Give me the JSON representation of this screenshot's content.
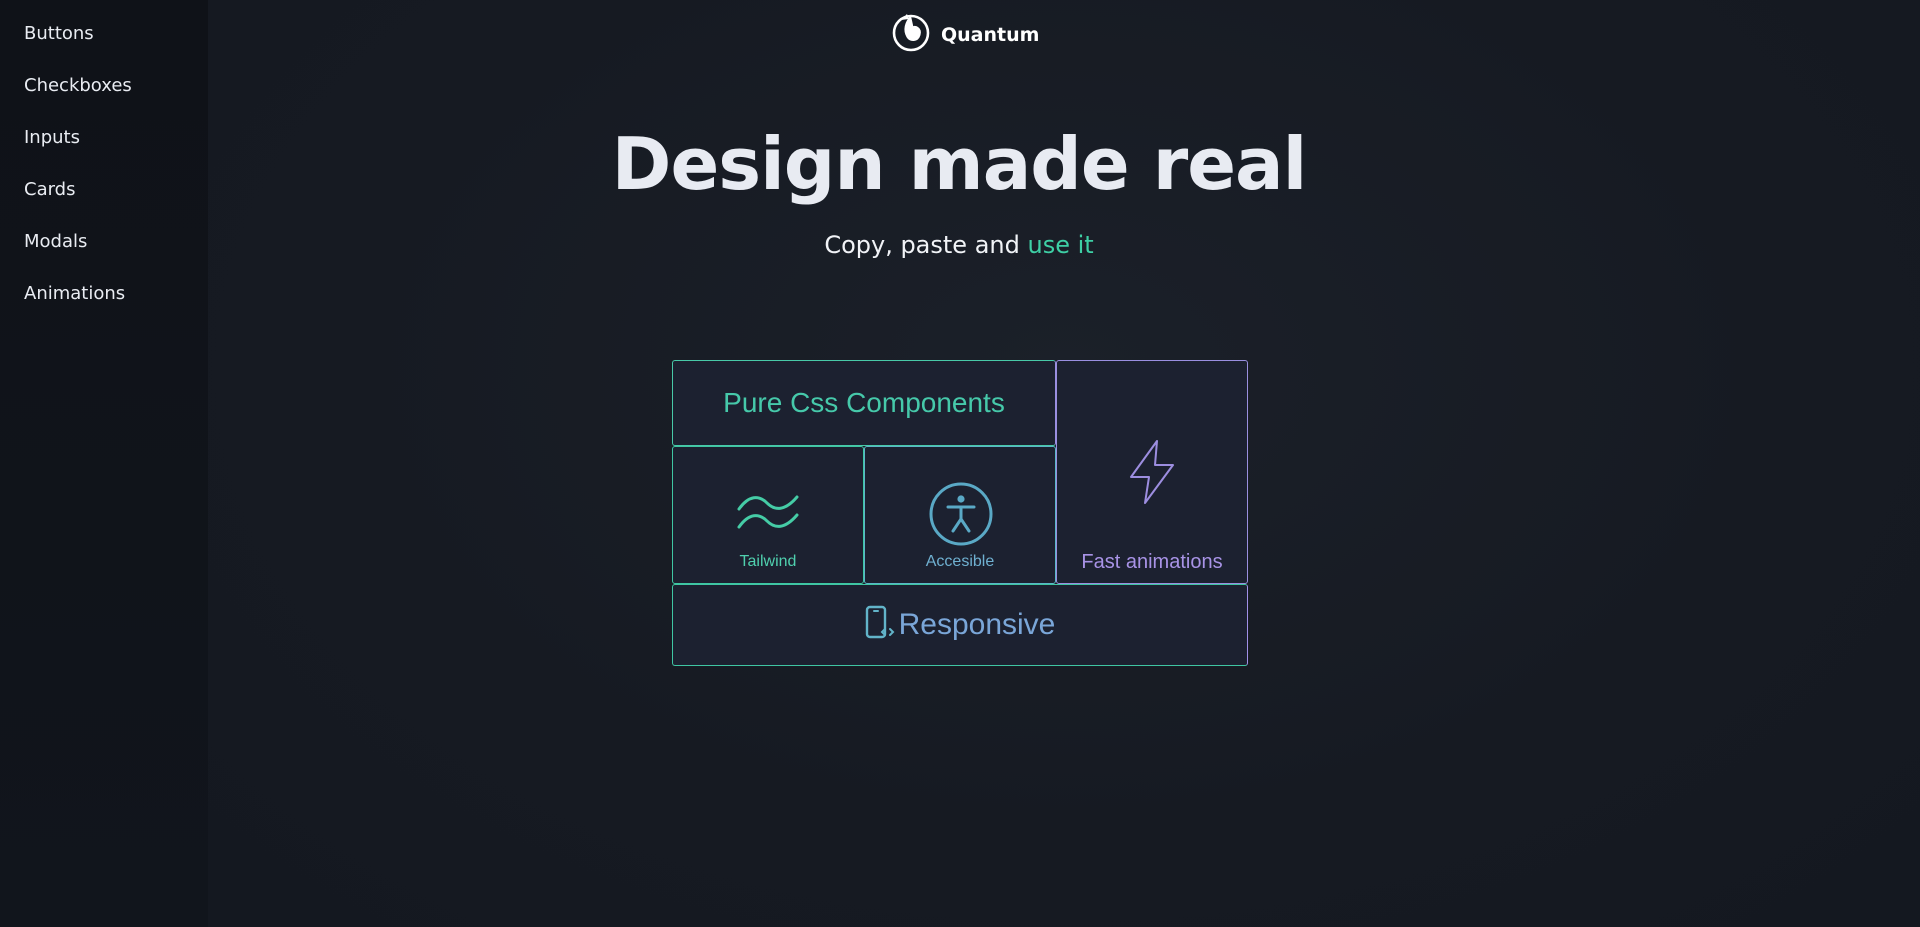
{
  "sidebar": {
    "items": [
      {
        "label": "Buttons"
      },
      {
        "label": "Checkboxes"
      },
      {
        "label": "Inputs"
      },
      {
        "label": "Cards"
      },
      {
        "label": "Modals"
      },
      {
        "label": "Animations"
      }
    ]
  },
  "header": {
    "brand": "Quantum",
    "logo_icon": "quantum-logo-icon"
  },
  "hero": {
    "title": "Design made real",
    "subtitle_prefix": "Copy, paste and ",
    "subtitle_accent": "use it"
  },
  "features": {
    "pure": {
      "label": "Pure Css Components"
    },
    "tailwind": {
      "label": "Tailwind",
      "icon": "tailwind-icon"
    },
    "accessible": {
      "label": "Accesible",
      "icon": "accessibility-icon"
    },
    "fast": {
      "label": "Fast animations",
      "icon": "lightning-icon"
    },
    "responsive": {
      "label": "Responsive",
      "icon": "responsive-phone-icon"
    }
  },
  "colors": {
    "background": "#161a23",
    "sidebar": "#0f1218",
    "accent_green": "#3ecfa5",
    "accent_purple": "#9a8fe0",
    "text": "#e8ebf2"
  }
}
